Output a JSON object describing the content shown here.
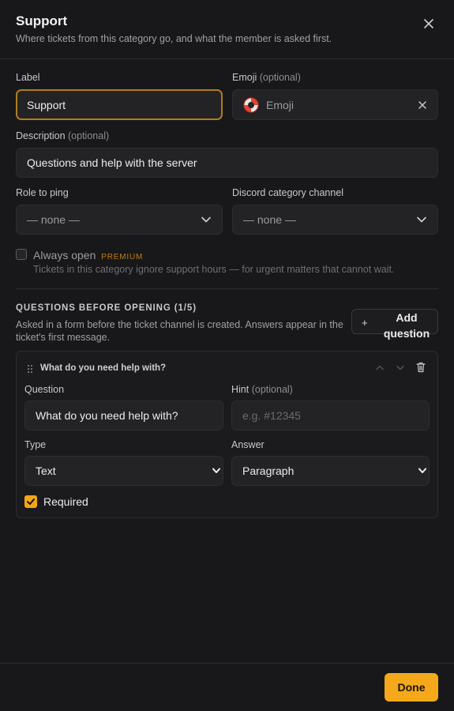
{
  "dialog": {
    "title": "Support",
    "subtitle": "Where tickets from this category go, and what the member is asked first."
  },
  "form": {
    "label_label": "Label",
    "label_value": "Support",
    "emoji_label": "Emoji",
    "emoji_optional": "(optional)",
    "emoji_placeholder": "Emoji",
    "description_label": "Description",
    "description_optional": "(optional)",
    "description_value": "Questions and help with the server",
    "role_label": "Role to ping",
    "role_value": "— none —",
    "category_label": "Discord category channel",
    "category_value": "— none —",
    "always_open_label": "Always open",
    "premium_badge": "PREMIUM",
    "always_open_desc": "Tickets in this category ignore support hours — for urgent matters that cannot wait."
  },
  "questions": {
    "heading": "QUESTIONS BEFORE OPENING (1/5)",
    "description": "Asked in a form before the ticket channel is created. Answers appear in the ticket's first message.",
    "add_label": "Add question",
    "items": [
      {
        "title": "What do you need help with?",
        "question_label": "Question",
        "question_value": "What do you need help with?",
        "hint_label": "Hint",
        "hint_optional": "(optional)",
        "hint_placeholder": "e.g. #12345",
        "type_label": "Type",
        "type_value": "Text",
        "answer_label": "Answer",
        "answer_value": "Paragraph",
        "required_label": "Required"
      }
    ]
  },
  "footer": {
    "done_label": "Done"
  },
  "colors": {
    "accent": "#f5a91a",
    "focus_border": "#b07d1f",
    "background": "#18181a"
  }
}
